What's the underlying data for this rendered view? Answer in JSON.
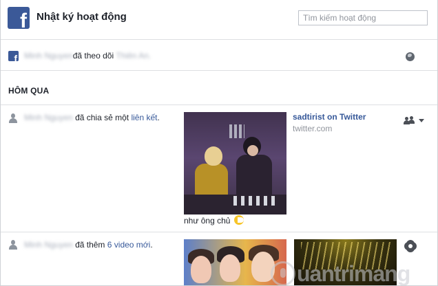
{
  "header": {
    "logo_letter": "f",
    "title": "Nhật ký hoạt động",
    "search_placeholder": "Tìm kiếm hoạt động"
  },
  "activity_follow": {
    "actor": "Minh Nguyen",
    "action": "đã theo dõi",
    "target": "Thiên An.",
    "privacy_icon": "globe-icon"
  },
  "section": {
    "title": "HÔM QUA"
  },
  "activity_share": {
    "actor": "Minh Nguyen",
    "action": "đã chia sẻ một",
    "link_text": "liên kết",
    "end": ".",
    "caption": "như ông chủ",
    "link_title": "sadtirist on Twitter",
    "link_domain": "twitter.com",
    "audience_icon": "friends-icon"
  },
  "activity_video": {
    "actor": "Minh Nguyen",
    "action": "đã thêm",
    "link_text": "6 video mới",
    "end": ".",
    "settings_icon": "gear-icon"
  },
  "watermark": {
    "text": "uantrimang"
  }
}
